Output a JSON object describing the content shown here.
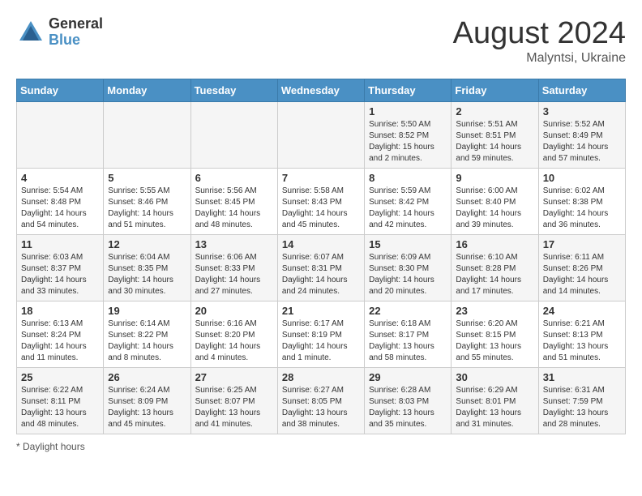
{
  "logo": {
    "general": "General",
    "blue": "Blue"
  },
  "header": {
    "month": "August 2024",
    "location": "Malyntsi, Ukraine"
  },
  "weekdays": [
    "Sunday",
    "Monday",
    "Tuesday",
    "Wednesday",
    "Thursday",
    "Friday",
    "Saturday"
  ],
  "weeks": [
    [
      {
        "day": "",
        "info": ""
      },
      {
        "day": "",
        "info": ""
      },
      {
        "day": "",
        "info": ""
      },
      {
        "day": "",
        "info": ""
      },
      {
        "day": "1",
        "info": "Sunrise: 5:50 AM\nSunset: 8:52 PM\nDaylight: 15 hours\nand 2 minutes."
      },
      {
        "day": "2",
        "info": "Sunrise: 5:51 AM\nSunset: 8:51 PM\nDaylight: 14 hours\nand 59 minutes."
      },
      {
        "day": "3",
        "info": "Sunrise: 5:52 AM\nSunset: 8:49 PM\nDaylight: 14 hours\nand 57 minutes."
      }
    ],
    [
      {
        "day": "4",
        "info": "Sunrise: 5:54 AM\nSunset: 8:48 PM\nDaylight: 14 hours\nand 54 minutes."
      },
      {
        "day": "5",
        "info": "Sunrise: 5:55 AM\nSunset: 8:46 PM\nDaylight: 14 hours\nand 51 minutes."
      },
      {
        "day": "6",
        "info": "Sunrise: 5:56 AM\nSunset: 8:45 PM\nDaylight: 14 hours\nand 48 minutes."
      },
      {
        "day": "7",
        "info": "Sunrise: 5:58 AM\nSunset: 8:43 PM\nDaylight: 14 hours\nand 45 minutes."
      },
      {
        "day": "8",
        "info": "Sunrise: 5:59 AM\nSunset: 8:42 PM\nDaylight: 14 hours\nand 42 minutes."
      },
      {
        "day": "9",
        "info": "Sunrise: 6:00 AM\nSunset: 8:40 PM\nDaylight: 14 hours\nand 39 minutes."
      },
      {
        "day": "10",
        "info": "Sunrise: 6:02 AM\nSunset: 8:38 PM\nDaylight: 14 hours\nand 36 minutes."
      }
    ],
    [
      {
        "day": "11",
        "info": "Sunrise: 6:03 AM\nSunset: 8:37 PM\nDaylight: 14 hours\nand 33 minutes."
      },
      {
        "day": "12",
        "info": "Sunrise: 6:04 AM\nSunset: 8:35 PM\nDaylight: 14 hours\nand 30 minutes."
      },
      {
        "day": "13",
        "info": "Sunrise: 6:06 AM\nSunset: 8:33 PM\nDaylight: 14 hours\nand 27 minutes."
      },
      {
        "day": "14",
        "info": "Sunrise: 6:07 AM\nSunset: 8:31 PM\nDaylight: 14 hours\nand 24 minutes."
      },
      {
        "day": "15",
        "info": "Sunrise: 6:09 AM\nSunset: 8:30 PM\nDaylight: 14 hours\nand 20 minutes."
      },
      {
        "day": "16",
        "info": "Sunrise: 6:10 AM\nSunset: 8:28 PM\nDaylight: 14 hours\nand 17 minutes."
      },
      {
        "day": "17",
        "info": "Sunrise: 6:11 AM\nSunset: 8:26 PM\nDaylight: 14 hours\nand 14 minutes."
      }
    ],
    [
      {
        "day": "18",
        "info": "Sunrise: 6:13 AM\nSunset: 8:24 PM\nDaylight: 14 hours\nand 11 minutes."
      },
      {
        "day": "19",
        "info": "Sunrise: 6:14 AM\nSunset: 8:22 PM\nDaylight: 14 hours\nand 8 minutes."
      },
      {
        "day": "20",
        "info": "Sunrise: 6:16 AM\nSunset: 8:20 PM\nDaylight: 14 hours\nand 4 minutes."
      },
      {
        "day": "21",
        "info": "Sunrise: 6:17 AM\nSunset: 8:19 PM\nDaylight: 14 hours\nand 1 minute."
      },
      {
        "day": "22",
        "info": "Sunrise: 6:18 AM\nSunset: 8:17 PM\nDaylight: 13 hours\nand 58 minutes."
      },
      {
        "day": "23",
        "info": "Sunrise: 6:20 AM\nSunset: 8:15 PM\nDaylight: 13 hours\nand 55 minutes."
      },
      {
        "day": "24",
        "info": "Sunrise: 6:21 AM\nSunset: 8:13 PM\nDaylight: 13 hours\nand 51 minutes."
      }
    ],
    [
      {
        "day": "25",
        "info": "Sunrise: 6:22 AM\nSunset: 8:11 PM\nDaylight: 13 hours\nand 48 minutes."
      },
      {
        "day": "26",
        "info": "Sunrise: 6:24 AM\nSunset: 8:09 PM\nDaylight: 13 hours\nand 45 minutes."
      },
      {
        "day": "27",
        "info": "Sunrise: 6:25 AM\nSunset: 8:07 PM\nDaylight: 13 hours\nand 41 minutes."
      },
      {
        "day": "28",
        "info": "Sunrise: 6:27 AM\nSunset: 8:05 PM\nDaylight: 13 hours\nand 38 minutes."
      },
      {
        "day": "29",
        "info": "Sunrise: 6:28 AM\nSunset: 8:03 PM\nDaylight: 13 hours\nand 35 minutes."
      },
      {
        "day": "30",
        "info": "Sunrise: 6:29 AM\nSunset: 8:01 PM\nDaylight: 13 hours\nand 31 minutes."
      },
      {
        "day": "31",
        "info": "Sunrise: 6:31 AM\nSunset: 7:59 PM\nDaylight: 13 hours\nand 28 minutes."
      }
    ]
  ],
  "footer": {
    "note": "Daylight hours"
  }
}
